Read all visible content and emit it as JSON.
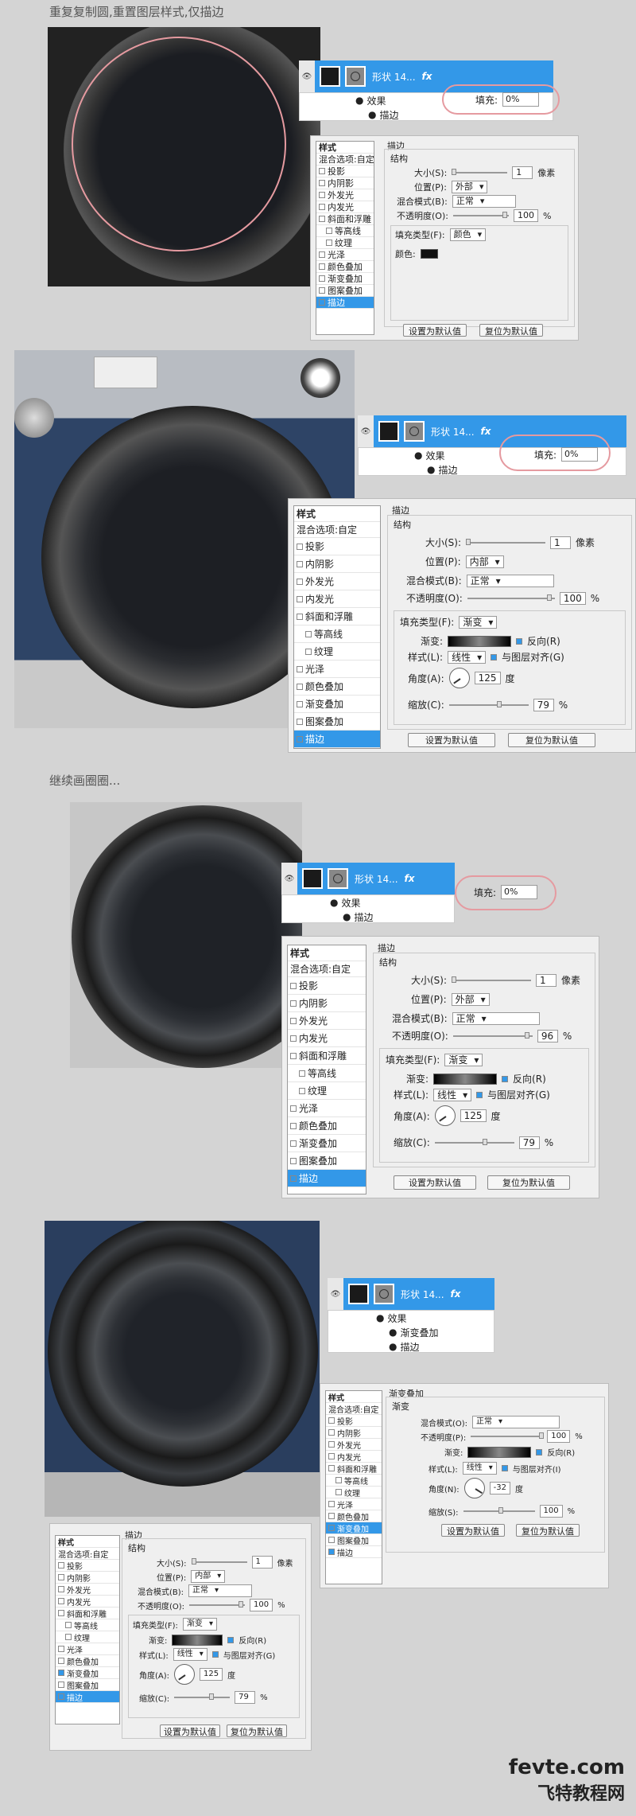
{
  "captions": {
    "cap1": "重复复制圆,重置图层样式,仅描边",
    "cap2": "继续画圈圈..."
  },
  "layer": {
    "name": "形状 14...",
    "fx": "fx",
    "effects": "效果",
    "stroke": "描边",
    "grad_overlay": "渐变叠加",
    "fill_label": "填充:",
    "fill_value": "0%"
  },
  "styles_list": {
    "header": "样式",
    "blend": "混合选项:自定",
    "items": [
      "投影",
      "内阴影",
      "外发光",
      "内发光",
      "斜面和浮雕",
      "等高线",
      "纹理",
      "光泽",
      "颜色叠加",
      "渐变叠加",
      "图案叠加",
      "描边"
    ]
  },
  "stroke_panel": {
    "title": "描边",
    "structure": "结构",
    "size_label": "大小(S):",
    "size_value": "1",
    "size_unit": "像素",
    "position_label": "位置(P):",
    "pos_outside": "外部",
    "pos_inside": "内部",
    "blend_label": "混合模式(B):",
    "blend_value": "正常",
    "opacity_label": "不透明度(O):",
    "pct": "%",
    "fill_type_label": "填充类型(F):",
    "ft_color": "颜色",
    "ft_gradient": "渐变",
    "color_label": "颜色:",
    "gradient_label": "渐变:",
    "reverse": "反向(R)",
    "style_label": "样式(L):",
    "style_value": "线性",
    "align": "与图层对齐(G)",
    "angle_label": "角度(A):",
    "angle_unit": "度",
    "scale_label": "缩放(C):",
    "btn_default": "设置为默认值",
    "btn_reset": "复位为默认值"
  },
  "dialog1": {
    "opacity": "100",
    "angle": "",
    "scale": ""
  },
  "dialog2": {
    "opacity": "100",
    "angle": "125",
    "scale": "79"
  },
  "dialog3": {
    "opacity": "96",
    "angle": "125",
    "scale": "79"
  },
  "dialog5": {
    "opacity": "100",
    "angle": "125",
    "scale": "79"
  },
  "grad_overlay_panel": {
    "title": "渐变叠加",
    "section": "渐变",
    "blend_label": "混合模式(O):",
    "blend_value": "正常",
    "opacity_label": "不透明度(P):",
    "opacity_value": "100",
    "gradient_label": "渐变:",
    "reverse": "反向(R)",
    "style_label": "样式(L):",
    "style_value": "线性",
    "align": "与图层对齐(I)",
    "angle_label": "角度(N):",
    "angle_value": "-32",
    "scale_label": "缩放(S):",
    "scale_value": "100"
  },
  "watermark": {
    "line1": "fevte.com",
    "line2": "飞特教程网"
  }
}
